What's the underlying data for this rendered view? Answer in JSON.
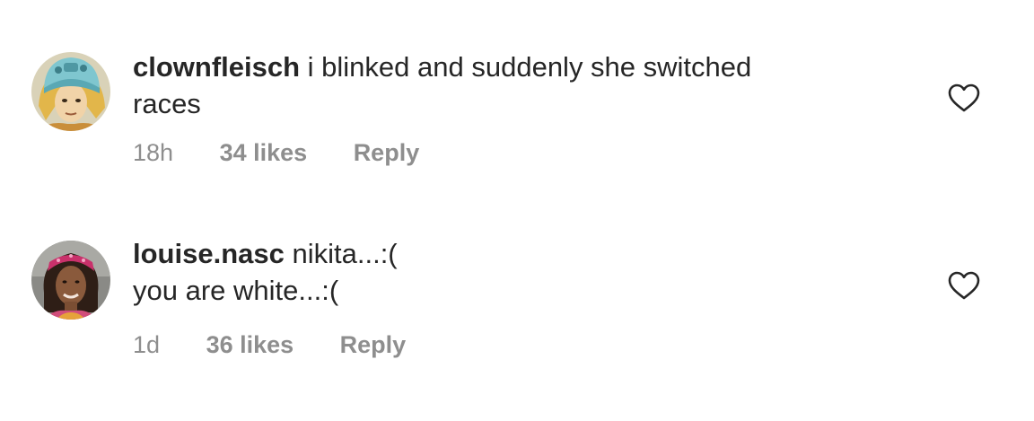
{
  "comments": [
    {
      "username": "clownfleisch",
      "text_line1": "i blinked and suddenly she switched",
      "text_line2": "races",
      "time": "18h",
      "likes": "34 likes",
      "reply": "Reply",
      "avatar_icon": "anime-character-avatar",
      "like_icon": "heart-outline-icon"
    },
    {
      "username": "louise.nasc",
      "text_line1": "nikita...:(",
      "text_line2": "you are white...:(",
      "time": "1d",
      "likes": "36 likes",
      "reply": "Reply",
      "avatar_icon": "profile-photo-avatar",
      "like_icon": "heart-outline-icon"
    }
  ],
  "colors": {
    "primary_text": "#262626",
    "secondary_text": "#8e8e8e",
    "background": "#ffffff"
  }
}
